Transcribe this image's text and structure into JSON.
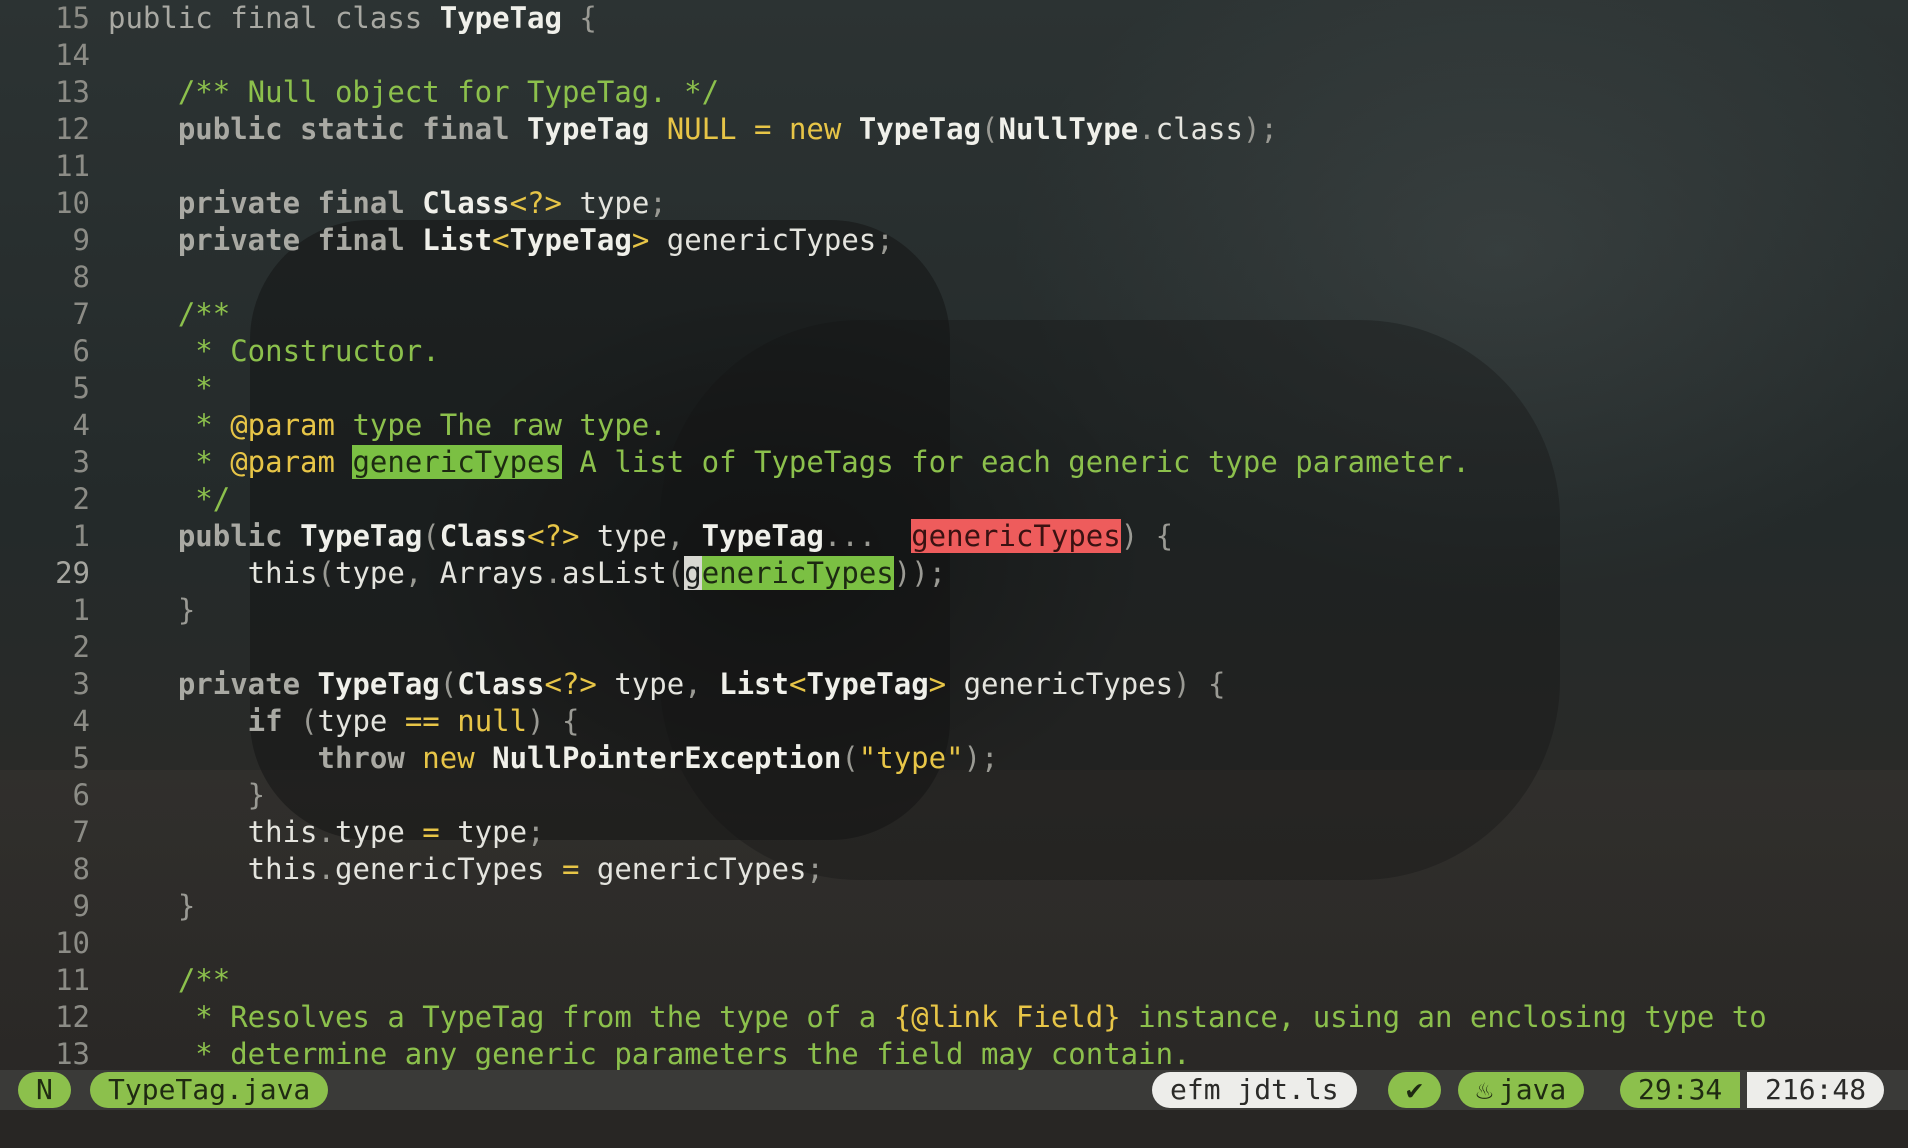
{
  "editor": {
    "lines": [
      {
        "num": "15",
        "segs": [
          [
            "kw",
            "public final class "
          ],
          [
            "ty",
            "TypeTag"
          ],
          [
            "p",
            " {"
          ]
        ]
      },
      {
        "num": "14",
        "segs": []
      },
      {
        "num": "13",
        "segs": [
          [
            "g",
            "    /** Null object for TypeTag. */"
          ]
        ]
      },
      {
        "num": "12",
        "segs": [
          [
            "kwb",
            "    public static final "
          ],
          [
            "ty",
            "TypeTag"
          ],
          [
            "y",
            " NULL"
          ],
          [
            "y",
            " = "
          ],
          [
            "y",
            "new "
          ],
          [
            "ty",
            "TypeTag"
          ],
          [
            "p",
            "("
          ],
          [
            "ty",
            "NullType"
          ],
          [
            "p",
            "."
          ],
          [
            "id",
            "class"
          ],
          [
            "p",
            ");"
          ]
        ]
      },
      {
        "num": "11",
        "segs": []
      },
      {
        "num": "10",
        "segs": [
          [
            "kwb",
            "    private final "
          ],
          [
            "ty",
            "Class"
          ],
          [
            "y",
            "<?> "
          ],
          [
            "id",
            "type"
          ],
          [
            "p",
            ";"
          ]
        ]
      },
      {
        "num": "9",
        "segs": [
          [
            "kwb",
            "    private final "
          ],
          [
            "ty",
            "List"
          ],
          [
            "y",
            "<"
          ],
          [
            "ty",
            "TypeTag"
          ],
          [
            "y",
            "> "
          ],
          [
            "id",
            "genericTypes"
          ],
          [
            "p",
            ";"
          ]
        ]
      },
      {
        "num": "8",
        "segs": []
      },
      {
        "num": "7",
        "segs": [
          [
            "g",
            "    /**"
          ]
        ]
      },
      {
        "num": "6",
        "segs": [
          [
            "g",
            "     * Constructor."
          ]
        ]
      },
      {
        "num": "5",
        "segs": [
          [
            "g",
            "     *"
          ]
        ]
      },
      {
        "num": "4",
        "segs": [
          [
            "g",
            "     * "
          ],
          [
            "y",
            "@param"
          ],
          [
            "g",
            " type The raw type."
          ]
        ]
      },
      {
        "num": "3",
        "segs": [
          [
            "g",
            "     * "
          ],
          [
            "y",
            "@param "
          ],
          [
            "hl-g",
            "genericTypes"
          ],
          [
            "g",
            " A list of TypeTags for each generic type parameter."
          ]
        ]
      },
      {
        "num": "2",
        "segs": [
          [
            "g",
            "     */"
          ]
        ]
      },
      {
        "num": "1",
        "segs": [
          [
            "kwb",
            "    public "
          ],
          [
            "ty",
            "TypeTag"
          ],
          [
            "p",
            "("
          ],
          [
            "ty",
            "Class"
          ],
          [
            "y",
            "<?> "
          ],
          [
            "id",
            "type"
          ],
          [
            "p",
            ", "
          ],
          [
            "ty",
            "TypeTag"
          ],
          [
            "p",
            "... "
          ],
          [
            "id",
            " "
          ],
          [
            "hl-r",
            "genericTypes"
          ],
          [
            "p",
            ") {"
          ]
        ]
      },
      {
        "num": "29",
        "cur": true,
        "segs": [
          [
            "id",
            "        this"
          ],
          [
            "p",
            "("
          ],
          [
            "id",
            "type"
          ],
          [
            "p",
            ", "
          ],
          [
            "id",
            "Arrays"
          ],
          [
            "p",
            "."
          ],
          [
            "id",
            "asList"
          ],
          [
            "p",
            "("
          ],
          [
            "cursor",
            "g"
          ],
          [
            "hl-g",
            "enericTypes"
          ],
          [
            "p",
            "));"
          ]
        ]
      },
      {
        "num": "1",
        "segs": [
          [
            "p",
            "    }"
          ]
        ]
      },
      {
        "num": "2",
        "segs": []
      },
      {
        "num": "3",
        "segs": [
          [
            "kwb",
            "    private "
          ],
          [
            "ty",
            "TypeTag"
          ],
          [
            "p",
            "("
          ],
          [
            "ty",
            "Class"
          ],
          [
            "y",
            "<?> "
          ],
          [
            "id",
            "type"
          ],
          [
            "p",
            ", "
          ],
          [
            "ty",
            "List"
          ],
          [
            "y",
            "<"
          ],
          [
            "ty",
            "TypeTag"
          ],
          [
            "y",
            "> "
          ],
          [
            "id",
            "genericTypes"
          ],
          [
            "p",
            ") {"
          ]
        ]
      },
      {
        "num": "4",
        "segs": [
          [
            "kwb",
            "        if "
          ],
          [
            "p",
            "("
          ],
          [
            "id",
            "type "
          ],
          [
            "y",
            "== "
          ],
          [
            "y",
            "null"
          ],
          [
            "p",
            ") {"
          ]
        ]
      },
      {
        "num": "5",
        "segs": [
          [
            "kwb",
            "            throw "
          ],
          [
            "y",
            "new "
          ],
          [
            "ty",
            "NullPointerException"
          ],
          [
            "p",
            "("
          ],
          [
            "y",
            "\"type\""
          ],
          [
            "p",
            ");"
          ]
        ]
      },
      {
        "num": "6",
        "segs": [
          [
            "p",
            "        }"
          ]
        ]
      },
      {
        "num": "7",
        "segs": [
          [
            "id",
            "        this"
          ],
          [
            "p",
            "."
          ],
          [
            "id",
            "type "
          ],
          [
            "y",
            "= "
          ],
          [
            "id",
            "type"
          ],
          [
            "p",
            ";"
          ]
        ]
      },
      {
        "num": "8",
        "segs": [
          [
            "id",
            "        this"
          ],
          [
            "p",
            "."
          ],
          [
            "id",
            "genericTypes "
          ],
          [
            "y",
            "= "
          ],
          [
            "id",
            "genericTypes"
          ],
          [
            "p",
            ";"
          ]
        ]
      },
      {
        "num": "9",
        "segs": [
          [
            "p",
            "    }"
          ]
        ]
      },
      {
        "num": "10",
        "segs": []
      },
      {
        "num": "11",
        "segs": [
          [
            "g",
            "    /**"
          ]
        ]
      },
      {
        "num": "12",
        "segs": [
          [
            "g",
            "     * Resolves a TypeTag from the type of a "
          ],
          [
            "y",
            "{@link Field}"
          ],
          [
            "g",
            " instance, using an enclosing type to"
          ]
        ]
      },
      {
        "num": "13",
        "segs": [
          [
            "g",
            "     * determine any generic parameters the field may contain."
          ]
        ]
      }
    ]
  },
  "statusbar": {
    "mode": "N",
    "filename": "TypeTag.java",
    "lsp_clients": "efm jdt.ls",
    "diagnostics_ok": "✔",
    "filetype_icon": "java-icon",
    "filetype": "java",
    "cursor_pos": "29:34",
    "buffer_info": "216:48"
  }
}
